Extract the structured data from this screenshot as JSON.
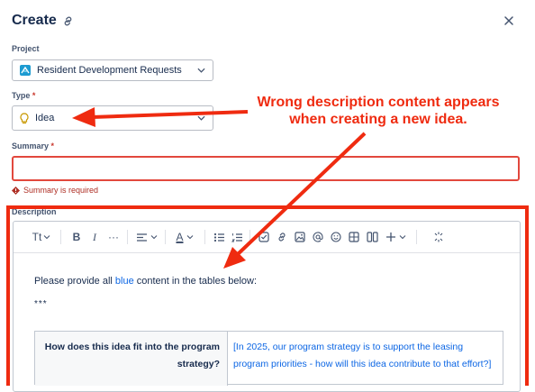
{
  "dialog": {
    "title": "Create"
  },
  "project": {
    "label": "Project",
    "value": "Resident Development Requests"
  },
  "type": {
    "label": "Type",
    "required_mark": "*",
    "value": "Idea"
  },
  "summary": {
    "label": "Summary",
    "required_mark": "*",
    "value": "",
    "error": "Summary is required"
  },
  "description": {
    "label": "Description",
    "toolbar": {
      "text_style": "Tt",
      "bold": "B",
      "italic": "I",
      "more": "···",
      "text_color": "A"
    },
    "intro_prefix": "Please provide all ",
    "intro_highlight": "blue",
    "intro_suffix": " content in the tables below:",
    "separator": "***",
    "table": {
      "question": "How does this idea fit into the program strategy?",
      "answer": "[In 2025, our program strategy is to support the leasing program priorities - how will this idea contribute to that effort?]"
    }
  },
  "annotation": {
    "text": "Wrong description content appears when creating a new idea.",
    "color": "#ef2b10"
  },
  "colors": {
    "error_border": "#e2483d",
    "link_blue": "#0c66e4",
    "project_icon": "#1d9bd1",
    "idea_icon": "#c99a06"
  }
}
